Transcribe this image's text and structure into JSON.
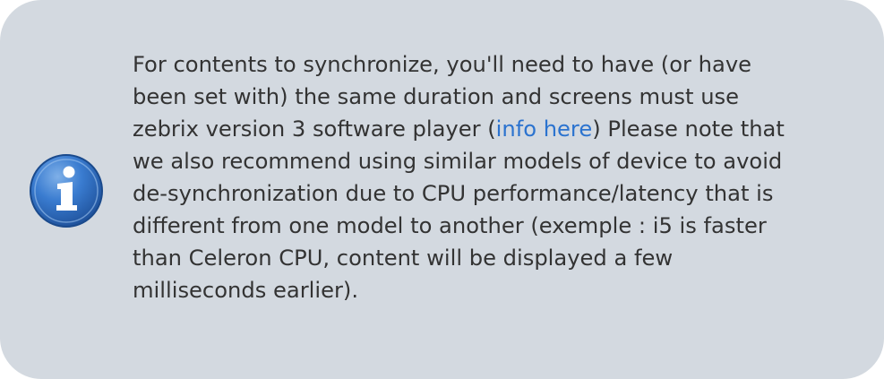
{
  "notice": {
    "icon": "info-icon",
    "colors": {
      "background": "#d3d9e0",
      "text": "#333333",
      "link": "#2b73cf",
      "icon_fill": "#2f6fbf"
    },
    "line1": "For contents to synchronize, you'll need to have (or have",
    "line2": "been set with) the same duration and screens must use",
    "line3_before": "zebrix version 3 software player (",
    "link_label": "info here",
    "line3_after": ") Please note that",
    "line4": "we also recommend using similar models of device to avoid",
    "line5": "de-synchronization due to CPU performance/latency that is",
    "line6": "different from one model to another (exemple : i5 is faster",
    "line7": "than Celeron CPU, content will be displayed a few",
    "line8": "milliseconds earlier)."
  }
}
